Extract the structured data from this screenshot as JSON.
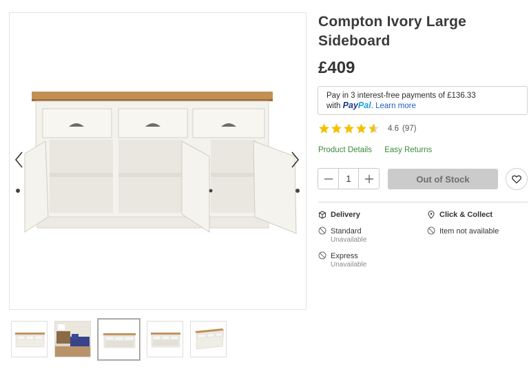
{
  "product": {
    "title": "Compton Ivory Large Sideboard",
    "price": "£409"
  },
  "paypal": {
    "line1": "Pay in 3 interest-free payments of £136.33",
    "with_label": "with",
    "logo_pay": "Pay",
    "logo_pal": "Pal",
    "period": ".",
    "learn_more": "Learn more"
  },
  "rating": {
    "stars": 4.6,
    "score": "4.6",
    "count": "(97)"
  },
  "links": {
    "product_details": "Product Details",
    "easy_returns": "Easy Returns"
  },
  "purchase": {
    "quantity": "1",
    "stock_button": "Out of Stock"
  },
  "delivery": {
    "heading": "Delivery",
    "options": [
      {
        "name": "Standard",
        "status": "Unavailable"
      },
      {
        "name": "Express",
        "status": "Unavailable"
      }
    ]
  },
  "click_collect": {
    "heading": "Click & Collect",
    "status": "Item not available"
  },
  "icons": {
    "gallery_prev": "chevron-left-icon",
    "gallery_next": "chevron-right-icon",
    "qty_minus": "minus-icon",
    "qty_plus": "plus-icon",
    "wishlist": "heart-icon",
    "delivery": "box-icon",
    "click_collect": "location-pin-icon",
    "unavailable": "prohibited-icon"
  },
  "colors": {
    "star": "#f2c200",
    "link_green": "#3a8a3a",
    "out_of_stock_bg": "#cbcbcb",
    "paypal_dark": "#1b3a87",
    "paypal_light": "#1c9ce0"
  }
}
